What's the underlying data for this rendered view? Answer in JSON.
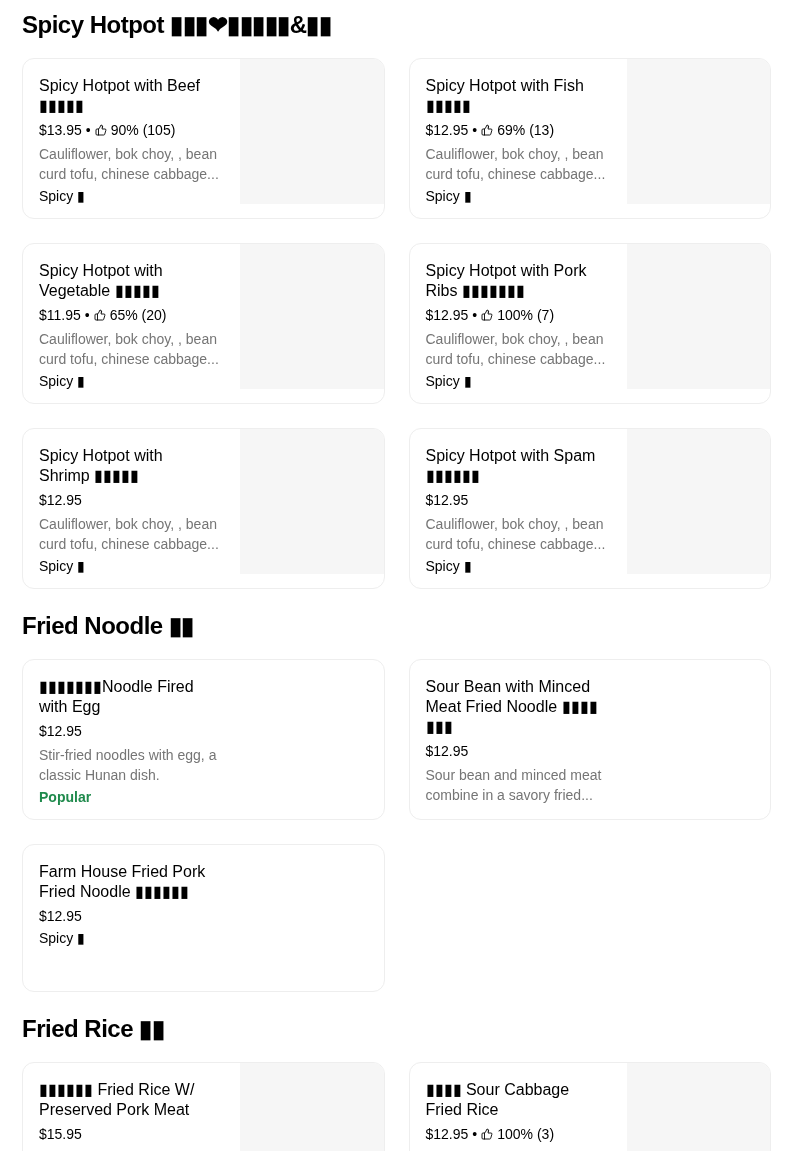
{
  "sections": [
    {
      "title": "Spicy Hotpot ▮▮▮❤▮▮▮▮▮&▮▮",
      "items": [
        {
          "name": "Spicy Hotpot with Beef ▮▮▮▮▮",
          "price": "$13.95",
          "separator": "•",
          "rating": "90% (105)",
          "description": "Cauliflower, bok choy, , bean curd tofu, chinese cabbage...",
          "tag": {
            "kind": "spicy",
            "label": "Spicy ▮"
          },
          "image_placeholder": true
        },
        {
          "name": "Spicy Hotpot with Fish ▮▮▮▮▮",
          "price": "$12.95",
          "separator": "•",
          "rating": "69% (13)",
          "description": "Cauliflower, bok choy, , bean curd tofu, chinese cabbage...",
          "tag": {
            "kind": "spicy",
            "label": "Spicy ▮"
          },
          "image_placeholder": true
        },
        {
          "name": "Spicy Hotpot with Vegetable ▮▮▮▮▮",
          "price": "$11.95",
          "separator": "•",
          "rating": "65% (20)",
          "description": "Cauliflower, bok choy, , bean curd tofu, chinese cabbage...",
          "tag": {
            "kind": "spicy",
            "label": "Spicy ▮"
          },
          "image_placeholder": true
        },
        {
          "name": "Spicy Hotpot with Pork Ribs ▮▮▮▮▮▮▮",
          "price": "$12.95",
          "separator": "•",
          "rating": "100% (7)",
          "description": "Cauliflower, bok choy, , bean curd tofu, chinese cabbage...",
          "tag": {
            "kind": "spicy",
            "label": "Spicy ▮"
          },
          "image_placeholder": true
        },
        {
          "name": "Spicy Hotpot with Shrimp ▮▮▮▮▮",
          "price": "$12.95",
          "description": "Cauliflower, bok choy, , bean curd tofu, chinese cabbage...",
          "tag": {
            "kind": "spicy",
            "label": "Spicy ▮"
          },
          "image_placeholder": true
        },
        {
          "name": "Spicy Hotpot with Spam ▮▮▮▮▮▮",
          "price": "$12.95",
          "description": "Cauliflower, bok choy, , bean curd tofu, chinese cabbage...",
          "tag": {
            "kind": "spicy",
            "label": "Spicy ▮"
          },
          "image_placeholder": true
        }
      ]
    },
    {
      "title": "Fried Noodle ▮▮",
      "items": [
        {
          "name": "▮▮▮▮▮▮▮Noodle Fired with Egg",
          "price": "$12.95",
          "description": "Stir-fried noodles with egg, a classic Hunan dish.",
          "tag": {
            "kind": "popular",
            "label": "Popular"
          },
          "image_placeholder": false
        },
        {
          "name": "Sour Bean with Minced Meat Fried Noodle ▮▮▮▮ ▮▮▮",
          "price": "$12.95",
          "description": "Sour bean and minced meat combine in a savory fried...",
          "image_placeholder": false
        },
        {
          "name": "Farm House Fried Pork Fried Noodle ▮▮▮▮▮▮",
          "price": "$12.95",
          "tag": {
            "kind": "spicy",
            "label": "Spicy ▮"
          },
          "image_placeholder": false
        }
      ]
    },
    {
      "title": "Fried Rice ▮▮",
      "items": [
        {
          "name": "▮▮▮▮▮▮ Fried Rice W/ Preserved Pork Meat",
          "price": "$15.95",
          "image_placeholder": true
        },
        {
          "name": "▮▮▮▮ Sour Cabbage Fried Rice",
          "price": "$12.95",
          "separator": "•",
          "rating": "100% (3)",
          "image_placeholder": true
        }
      ]
    }
  ]
}
